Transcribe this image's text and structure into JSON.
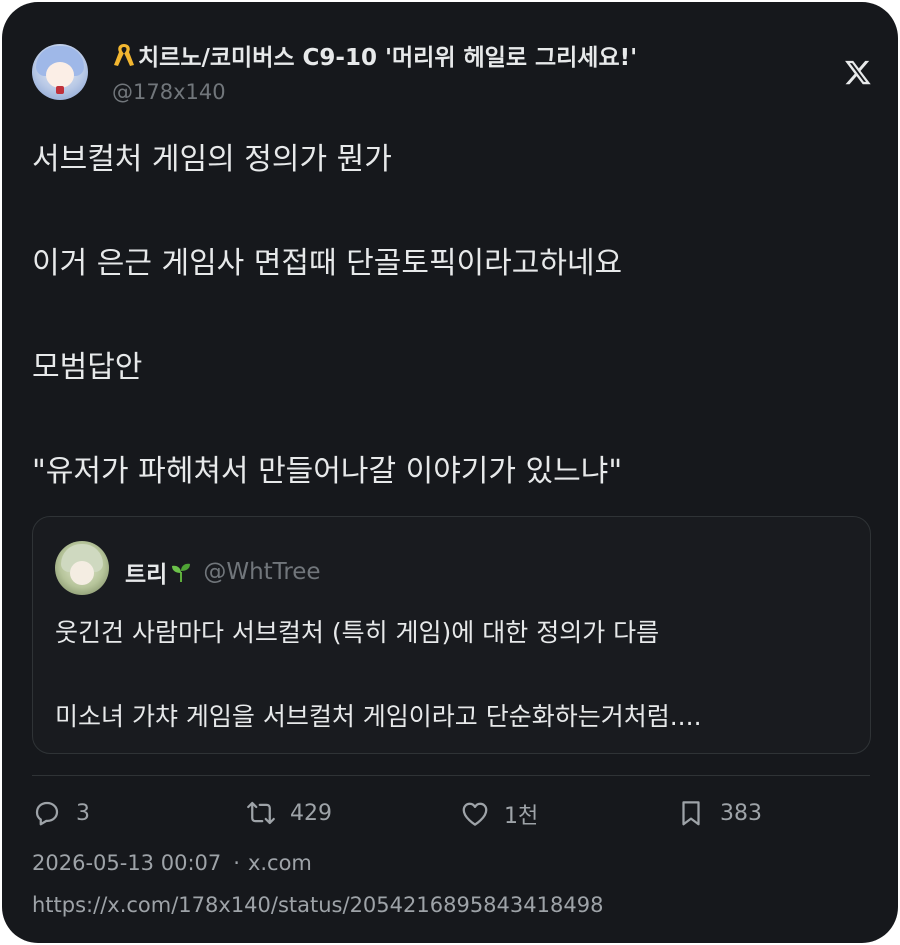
{
  "author": {
    "display_name": "치르노/코미버스 C9-10 '머리위 헤일로 그리세요!'",
    "handle": "@178x140",
    "ribbon_icon": "yellow-ribbon-icon"
  },
  "tweet": {
    "lines": [
      "서브컬처 게임의 정의가 뭔가",
      "이거 은근 게임사 면접때 단골토픽이라고하네요",
      "모범답안",
      "\"유저가 파헤쳐서 만들어나갈 이야기가 있느냐\""
    ]
  },
  "quoted": {
    "display_name": "트리",
    "name_icon": "sprout-icon",
    "handle": "@WhtTree",
    "line1": "웃긴건 사람마다 서브컬처 (특히 게임)에 대한 정의가 다름",
    "line2": "미소녀 가챠 게임을 서브컬처 게임이라고 단순화하는거처럼...."
  },
  "stats": {
    "replies": "3",
    "retweets": "429",
    "likes": "1천",
    "bookmarks": "383"
  },
  "meta": {
    "timestamp": "2026-05-13 00:07",
    "separator": "·",
    "source": "x.com",
    "url": "https://x.com/178x140/status/2054216895843418498"
  },
  "colors": {
    "background": "#16181c",
    "text": "#e7e9ea",
    "muted": "#71767b",
    "border": "#2f3336"
  }
}
